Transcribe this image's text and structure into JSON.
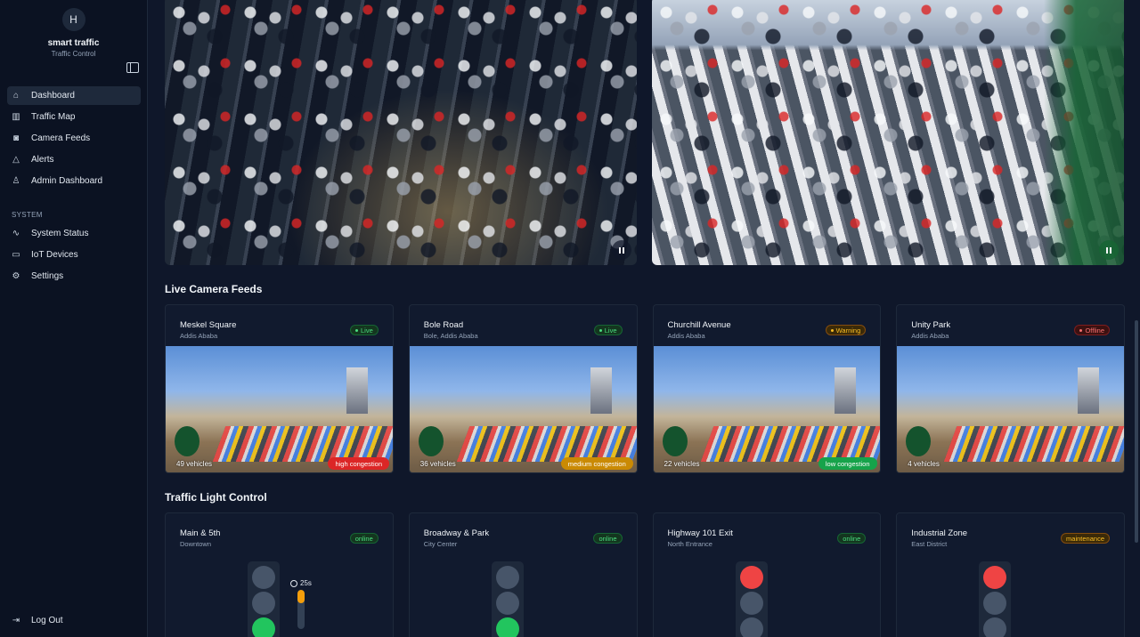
{
  "sidebar": {
    "avatar_letter": "H",
    "brand_name": "smart traffic",
    "brand_sub": "Traffic Control",
    "nav": [
      {
        "label": "Dashboard",
        "icon": "home-icon",
        "active": true
      },
      {
        "label": "Traffic Map",
        "icon": "map-icon"
      },
      {
        "label": "Camera Feeds",
        "icon": "camera-icon"
      },
      {
        "label": "Alerts",
        "icon": "alert-icon"
      },
      {
        "label": "Admin Dashboard",
        "icon": "user-icon"
      }
    ],
    "section_label": "SYSTEM",
    "system_nav": [
      {
        "label": "System Status",
        "icon": "activity-icon"
      },
      {
        "label": "IoT Devices",
        "icon": "hard-drive-icon"
      },
      {
        "label": "Settings",
        "icon": "gear-icon"
      }
    ],
    "logout_label": "Log Out"
  },
  "main": {
    "live_feeds_title": "Live Camera Feeds",
    "cameras": [
      {
        "name": "Meskel Square",
        "location": "Addis Ababa",
        "status": "Live",
        "vehicles": "49 vehicles",
        "congestion": "high congestion"
      },
      {
        "name": "Bole Road",
        "location": "Bole, Addis Ababa",
        "status": "Live",
        "vehicles": "36 vehicles",
        "congestion": "medium congestion"
      },
      {
        "name": "Churchill Avenue",
        "location": "Addis Ababa",
        "status": "Warning",
        "vehicles": "22 vehicles",
        "congestion": "low congestion"
      },
      {
        "name": "Unity Park",
        "location": "Addis Ababa",
        "status": "Offline",
        "vehicles": "4 vehicles",
        "congestion": ""
      }
    ],
    "traffic_light_title": "Traffic Light Control",
    "lights": [
      {
        "name": "Main & 5th",
        "location": "Downtown",
        "status": "online",
        "active_lamp": "green",
        "timer": "25s",
        "timer_fraction": 0.35
      },
      {
        "name": "Broadway & Park",
        "location": "City Center",
        "status": "online",
        "active_lamp": "green"
      },
      {
        "name": "Highway 101 Exit",
        "location": "North Entrance",
        "status": "online",
        "active_lamp": "red"
      },
      {
        "name": "Industrial Zone",
        "location": "East District",
        "status": "maintenance",
        "active_lamp": "red"
      }
    ]
  }
}
